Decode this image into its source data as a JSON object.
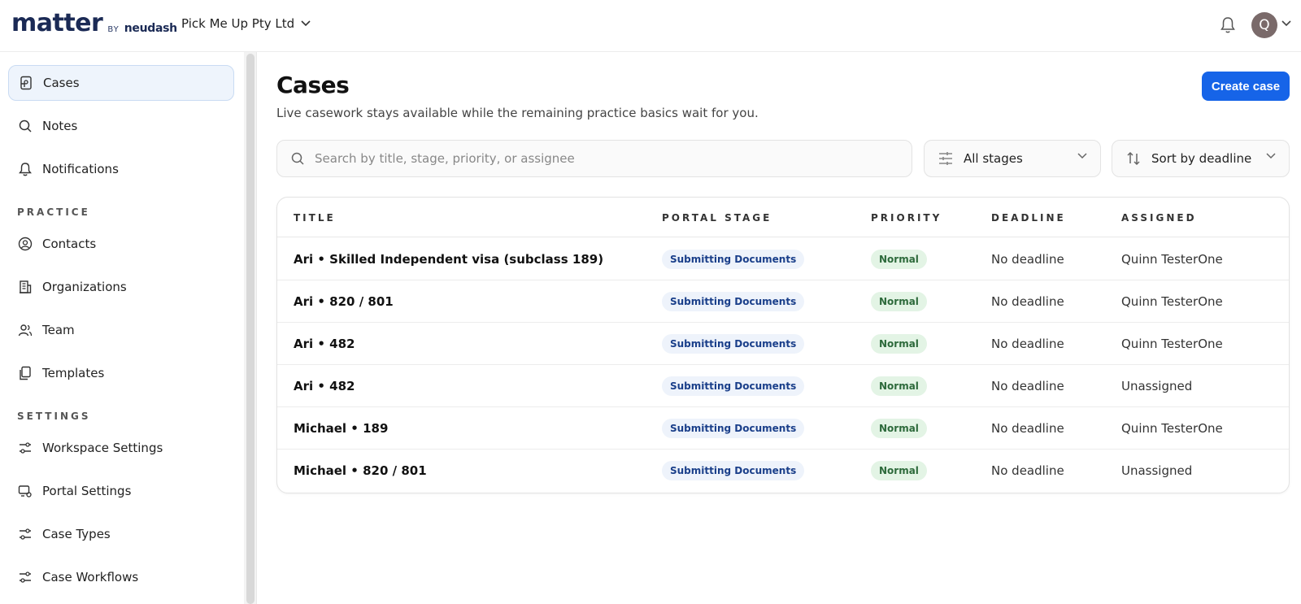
{
  "brand": {
    "name": "matter",
    "by": "BY",
    "sub": "neudash"
  },
  "org": {
    "name": "Pick Me Up Pty Ltd"
  },
  "user": {
    "initial": "Q"
  },
  "sidebar": {
    "items_main": [
      {
        "label": "Cases",
        "icon": "cases-icon",
        "active": true
      },
      {
        "label": "Notes",
        "icon": "search-icon"
      },
      {
        "label": "Notifications",
        "icon": "bell-icon"
      }
    ],
    "practice_label": "PRACTICE",
    "items_practice": [
      {
        "label": "Contacts",
        "icon": "contact-icon"
      },
      {
        "label": "Organizations",
        "icon": "building-icon"
      },
      {
        "label": "Team",
        "icon": "team-icon"
      },
      {
        "label": "Templates",
        "icon": "templates-icon"
      }
    ],
    "settings_label": "SETTINGS",
    "items_settings": [
      {
        "label": "Workspace Settings",
        "icon": "sliders-icon"
      },
      {
        "label": "Portal Settings",
        "icon": "portal-icon"
      },
      {
        "label": "Case Types",
        "icon": "sliders-icon"
      },
      {
        "label": "Case Workflows",
        "icon": "sliders-icon"
      }
    ]
  },
  "main": {
    "title": "Cases",
    "subtitle": "Live casework stays available while the remaining practice basics wait for you.",
    "create_label": "Create case",
    "search_placeholder": "Search by title, stage, priority, or assignee",
    "stage_filter": "All stages",
    "sort": "Sort by deadline",
    "columns": [
      "TITLE",
      "PORTAL STAGE",
      "PRIORITY",
      "DEADLINE",
      "ASSIGNED"
    ],
    "rows": [
      {
        "title": "Ari • Skilled Independent visa (subclass 189)",
        "stage": "Submitting Documents",
        "priority": "Normal",
        "deadline": "No deadline",
        "assigned": "Quinn TesterOne"
      },
      {
        "title": "Ari • 820 / 801",
        "stage": "Submitting Documents",
        "priority": "Normal",
        "deadline": "No deadline",
        "assigned": "Quinn TesterOne"
      },
      {
        "title": "Ari • 482",
        "stage": "Submitting Documents",
        "priority": "Normal",
        "deadline": "No deadline",
        "assigned": "Quinn TesterOne"
      },
      {
        "title": "Ari • 482",
        "stage": "Submitting Documents",
        "priority": "Normal",
        "deadline": "No deadline",
        "assigned": "Unassigned"
      },
      {
        "title": "Michael • 189",
        "stage": "Submitting Documents",
        "priority": "Normal",
        "deadline": "No deadline",
        "assigned": "Quinn TesterOne"
      },
      {
        "title": "Michael • 820 / 801",
        "stage": "Submitting Documents",
        "priority": "Normal",
        "deadline": "No deadline",
        "assigned": "Unassigned"
      }
    ]
  },
  "colors": {
    "accent": "#1664e8",
    "brand": "#1b2a55",
    "active_bg": "#eef4fc",
    "priority_bg": "#e3f4e5",
    "stage_bg": "#eef3fb"
  }
}
